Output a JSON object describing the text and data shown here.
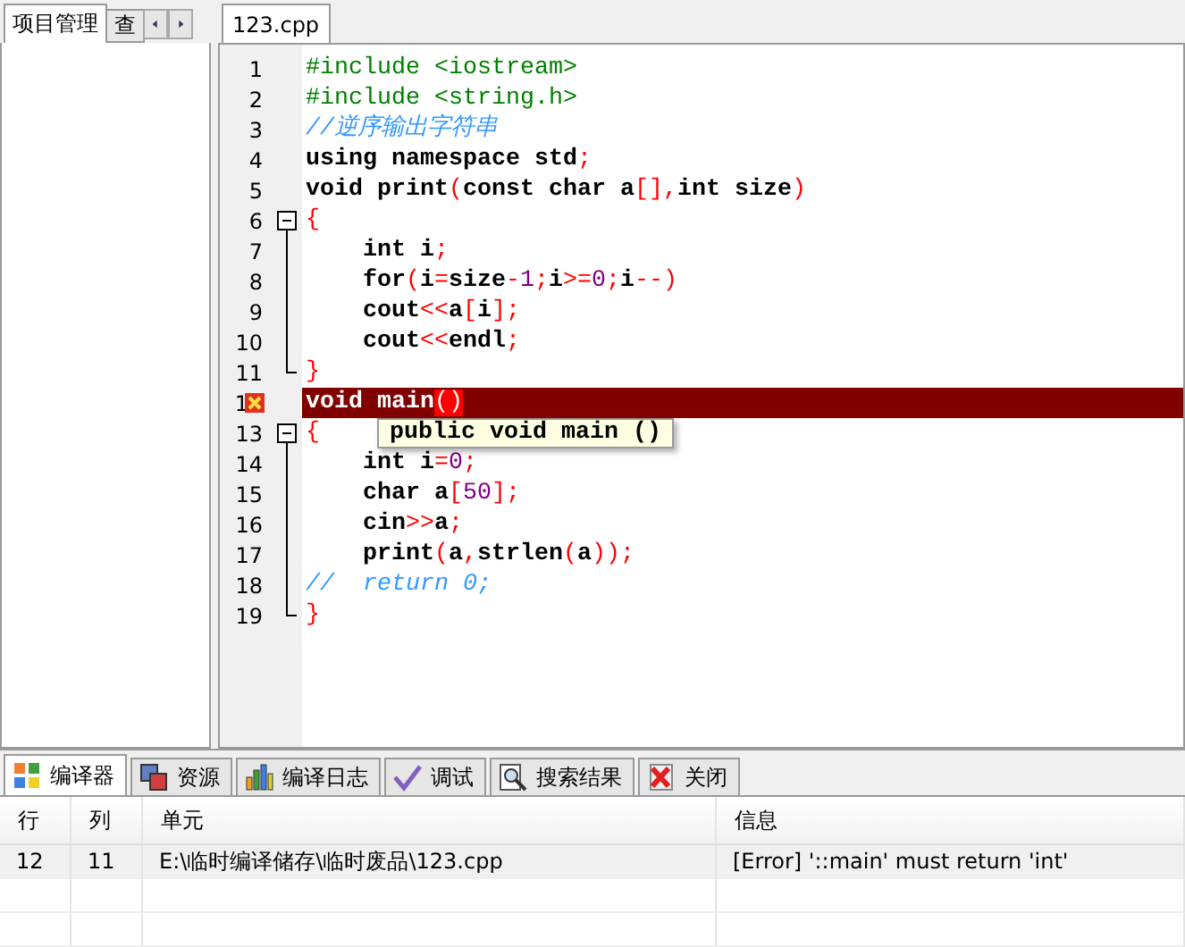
{
  "project_panel": {
    "tabs": [
      {
        "label": "项目管理",
        "selected": true
      },
      {
        "label": "查",
        "selected": false
      }
    ]
  },
  "editor": {
    "tabs": [
      {
        "label": "123.cpp",
        "selected": true
      }
    ],
    "lines": [
      {
        "no": "1",
        "kind": "plain",
        "error": false,
        "tokens": [
          {
            "text": "#include <iostream>",
            "kind": "pre"
          }
        ]
      },
      {
        "no": "2",
        "kind": "plain",
        "error": false,
        "tokens": [
          {
            "text": "#include <string.h>",
            "kind": "pre"
          }
        ]
      },
      {
        "no": "3",
        "kind": "plain",
        "error": false,
        "tokens": [
          {
            "text": "//逆序输出字符串",
            "kind": "cmt"
          }
        ]
      },
      {
        "no": "4",
        "kind": "plain",
        "error": false,
        "tokens": [
          {
            "text": "using namespace std",
            "kind": "kw"
          },
          {
            "text": ";",
            "kind": "sym"
          }
        ]
      },
      {
        "no": "5",
        "kind": "plain",
        "error": false,
        "tokens": [
          {
            "text": "void print",
            "kind": "kw"
          },
          {
            "text": "(",
            "kind": "sym"
          },
          {
            "text": "const char a",
            "kind": "kw"
          },
          {
            "text": "[],",
            "kind": "sym"
          },
          {
            "text": "int size",
            "kind": "kw"
          },
          {
            "text": ")",
            "kind": "sym"
          }
        ]
      },
      {
        "no": "6",
        "kind": "fold_start",
        "error": false,
        "tokens": [
          {
            "text": "{",
            "kind": "sym"
          }
        ]
      },
      {
        "no": "7",
        "kind": "fold_mid",
        "error": false,
        "tokens": [
          {
            "text": "    int i",
            "kind": "kw"
          },
          {
            "text": ";",
            "kind": "sym"
          }
        ]
      },
      {
        "no": "8",
        "kind": "fold_mid",
        "error": false,
        "tokens": [
          {
            "text": "    for",
            "kind": "kw"
          },
          {
            "text": "(",
            "kind": "sym"
          },
          {
            "text": "i",
            "kind": "kw"
          },
          {
            "text": "=",
            "kind": "sym"
          },
          {
            "text": "size",
            "kind": "kw"
          },
          {
            "text": "-",
            "kind": "sym"
          },
          {
            "text": "1",
            "kind": "num"
          },
          {
            "text": ";",
            "kind": "sym"
          },
          {
            "text": "i",
            "kind": "kw"
          },
          {
            "text": ">=",
            "kind": "sym"
          },
          {
            "text": "0",
            "kind": "num"
          },
          {
            "text": ";",
            "kind": "sym"
          },
          {
            "text": "i",
            "kind": "kw"
          },
          {
            "text": "--)",
            "kind": "sym"
          }
        ]
      },
      {
        "no": "9",
        "kind": "fold_mid",
        "error": false,
        "tokens": [
          {
            "text": "    cout",
            "kind": "kw"
          },
          {
            "text": "<<",
            "kind": "sym"
          },
          {
            "text": "a",
            "kind": "kw"
          },
          {
            "text": "[",
            "kind": "sym"
          },
          {
            "text": "i",
            "kind": "kw"
          },
          {
            "text": "];",
            "kind": "sym"
          }
        ]
      },
      {
        "no": "10",
        "kind": "fold_mid",
        "error": false,
        "tokens": [
          {
            "text": "    cout",
            "kind": "kw"
          },
          {
            "text": "<<",
            "kind": "sym"
          },
          {
            "text": "endl",
            "kind": "kw"
          },
          {
            "text": ";",
            "kind": "sym"
          }
        ]
      },
      {
        "no": "11",
        "kind": "fold_end",
        "error": false,
        "tokens": [
          {
            "text": "}",
            "kind": "sym"
          }
        ]
      },
      {
        "no": "1",
        "kind": "plain",
        "error": true,
        "tokens": [
          {
            "text": "void main",
            "kind": "kw"
          },
          {
            "text": "()",
            "kind": "hl"
          }
        ]
      },
      {
        "no": "13",
        "kind": "fold_start",
        "error": false,
        "tokens": [
          {
            "text": "{",
            "kind": "sym"
          }
        ]
      },
      {
        "no": "14",
        "kind": "fold_mid",
        "error": false,
        "tokens": [
          {
            "text": "    int i",
            "kind": "kw"
          },
          {
            "text": "=",
            "kind": "sym"
          },
          {
            "text": "0",
            "kind": "num"
          },
          {
            "text": ";",
            "kind": "sym"
          }
        ]
      },
      {
        "no": "15",
        "kind": "fold_mid",
        "error": false,
        "tokens": [
          {
            "text": "    char a",
            "kind": "kw"
          },
          {
            "text": "[",
            "kind": "sym"
          },
          {
            "text": "50",
            "kind": "num"
          },
          {
            "text": "];",
            "kind": "sym"
          }
        ]
      },
      {
        "no": "16",
        "kind": "fold_mid",
        "error": false,
        "tokens": [
          {
            "text": "    cin",
            "kind": "kw"
          },
          {
            "text": ">>",
            "kind": "sym"
          },
          {
            "text": "a",
            "kind": "kw"
          },
          {
            "text": ";",
            "kind": "sym"
          }
        ]
      },
      {
        "no": "17",
        "kind": "fold_mid",
        "error": false,
        "tokens": [
          {
            "text": "    print",
            "kind": "kw"
          },
          {
            "text": "(",
            "kind": "sym"
          },
          {
            "text": "a",
            "kind": "kw"
          },
          {
            "text": ",",
            "kind": "sym"
          },
          {
            "text": "strlen",
            "kind": "kw"
          },
          {
            "text": "(",
            "kind": "sym"
          },
          {
            "text": "a",
            "kind": "kw"
          },
          {
            "text": "));",
            "kind": "sym"
          }
        ]
      },
      {
        "no": "18",
        "kind": "fold_mid",
        "error": false,
        "tokens": [
          {
            "text": "//  return 0;",
            "kind": "cmt"
          }
        ]
      },
      {
        "no": "19",
        "kind": "fold_end",
        "error": false,
        "tokens": [
          {
            "text": "}",
            "kind": "sym"
          }
        ]
      }
    ],
    "tooltip": "public void main ()"
  },
  "output_panel": {
    "tabs": [
      {
        "label": "编译器",
        "kind": "grid",
        "selected": true
      },
      {
        "label": "资源",
        "kind": "layers",
        "selected": false
      },
      {
        "label": "编译日志",
        "kind": "bars",
        "selected": false
      },
      {
        "label": "调试",
        "kind": "check",
        "selected": false
      },
      {
        "label": "搜索结果",
        "kind": "search",
        "selected": false
      },
      {
        "label": "关闭",
        "kind": "close",
        "selected": false
      }
    ],
    "table": {
      "columns": [
        "行",
        "列",
        "单元",
        "信息"
      ],
      "rows": [
        [
          "12",
          "11",
          "E:\\临时编译储存\\临时废品\\123.cpp",
          "[Error] '::main' must return 'int'"
        ]
      ]
    }
  }
}
